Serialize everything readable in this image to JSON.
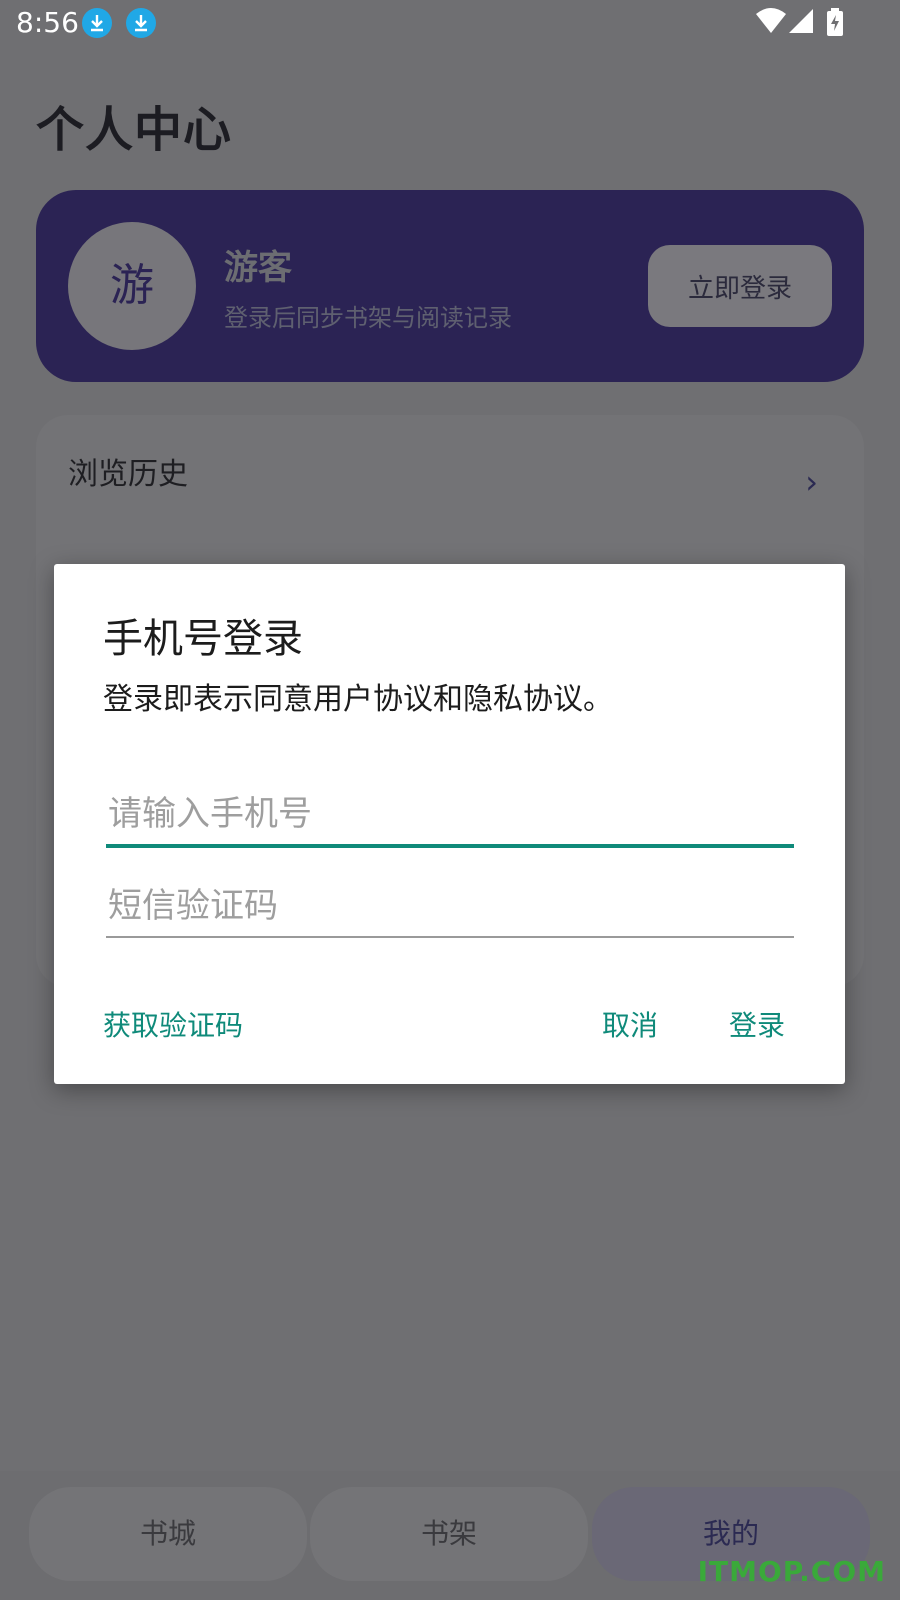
{
  "status_bar": {
    "time": "8:56",
    "icons": [
      "download-icon",
      "download-icon",
      "wifi-icon",
      "signal-icon",
      "battery-charging-icon"
    ]
  },
  "page": {
    "title": "个人中心"
  },
  "profile": {
    "avatar_char": "游",
    "name": "游客",
    "subtitle": "登录后同步书架与阅读记录",
    "login_button": "立即登录"
  },
  "history": {
    "label": "浏览历史",
    "chevron": "›"
  },
  "dialog": {
    "title": "手机号登录",
    "description": "登录即表示同意用户协议和隐私协议。",
    "phone_placeholder": "请输入手机号",
    "code_placeholder": "短信验证码",
    "get_code": "获取验证码",
    "cancel": "取消",
    "login": "登录"
  },
  "bottom_nav": {
    "items": [
      {
        "label": "书城"
      },
      {
        "label": "书架"
      },
      {
        "label": "我的"
      }
    ],
    "active": "我的"
  },
  "watermark": "ITMOP.COM",
  "colors": {
    "accent": "#0f8a7a",
    "profile_card": "#2b2354",
    "scrim": "#6f6f72"
  }
}
